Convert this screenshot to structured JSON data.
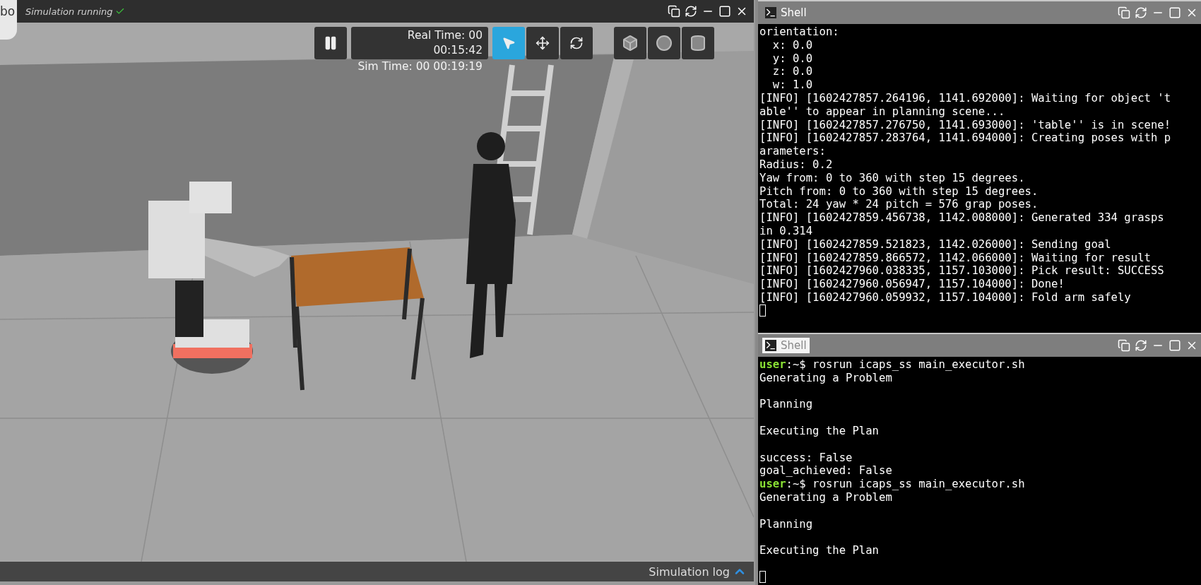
{
  "sim_window": {
    "tab_label": "bo",
    "status": "Simulation running",
    "status_ok": true,
    "toolbar": {
      "paused": false,
      "real_time_label": "Real Time: 00",
      "real_time_value": "00:15:42",
      "sim_time": "Sim Time: 00 00:19:19",
      "modes": [
        {
          "kind": "select",
          "selected": true
        },
        {
          "kind": "translate",
          "selected": false
        },
        {
          "kind": "rotate",
          "selected": false
        }
      ],
      "shapes": [
        {
          "kind": "box"
        },
        {
          "kind": "sphere"
        },
        {
          "kind": "cylinder"
        }
      ]
    },
    "log_label": "Simulation log"
  },
  "shells": [
    {
      "title": "Shell",
      "highlighted": false,
      "lines": [
        {
          "kind": "text",
          "text": "orientation:"
        },
        {
          "kind": "text",
          "text": "  x: 0.0"
        },
        {
          "kind": "text",
          "text": "  y: 0.0"
        },
        {
          "kind": "text",
          "text": "  z: 0.0"
        },
        {
          "kind": "text",
          "text": "  w: 1.0"
        },
        {
          "kind": "text",
          "text": "[INFO] [1602427857.264196, 1141.692000]: Waiting for object 't"
        },
        {
          "kind": "text",
          "text": "able'' to appear in planning scene..."
        },
        {
          "kind": "text",
          "text": "[INFO] [1602427857.276750, 1141.693000]: 'table'' is in scene!"
        },
        {
          "kind": "text",
          "text": "[INFO] [1602427857.283764, 1141.694000]: Creating poses with p"
        },
        {
          "kind": "text",
          "text": "arameters:"
        },
        {
          "kind": "text",
          "text": "Radius: 0.2"
        },
        {
          "kind": "text",
          "text": "Yaw from: 0 to 360 with step 15 degrees."
        },
        {
          "kind": "text",
          "text": "Pitch from: 0 to 360 with step 15 degrees."
        },
        {
          "kind": "text",
          "text": "Total: 24 yaw * 24 pitch = 576 grap poses."
        },
        {
          "kind": "text",
          "text": "[INFO] [1602427859.456738, 1142.008000]: Generated 334 grasps"
        },
        {
          "kind": "text",
          "text": "in 0.314"
        },
        {
          "kind": "text",
          "text": "[INFO] [1602427859.521823, 1142.026000]: Sending goal"
        },
        {
          "kind": "text",
          "text": "[INFO] [1602427859.866572, 1142.066000]: Waiting for result"
        },
        {
          "kind": "text",
          "text": "[INFO] [1602427960.038335, 1157.103000]: Pick result: SUCCESS"
        },
        {
          "kind": "text",
          "text": "[INFO] [1602427960.056947, 1157.104000]: Done!"
        },
        {
          "kind": "text",
          "text": "[INFO] [1602427960.059932, 1157.104000]: Fold arm safely"
        },
        {
          "kind": "cursor"
        }
      ]
    },
    {
      "title": "Shell",
      "highlighted": true,
      "lines": [
        {
          "kind": "prompt",
          "user": "user",
          "text": ":~$ rosrun icaps_ss main_executor.sh"
        },
        {
          "kind": "text",
          "text": "Generating a Problem"
        },
        {
          "kind": "blank"
        },
        {
          "kind": "text",
          "text": "Planning"
        },
        {
          "kind": "blank"
        },
        {
          "kind": "text",
          "text": "Executing the Plan"
        },
        {
          "kind": "blank"
        },
        {
          "kind": "text",
          "text": "success: False"
        },
        {
          "kind": "text",
          "text": "goal_achieved: False"
        },
        {
          "kind": "prompt",
          "user": "user",
          "text": ":~$ rosrun icaps_ss main_executor.sh"
        },
        {
          "kind": "text",
          "text": "Generating a Problem"
        },
        {
          "kind": "blank"
        },
        {
          "kind": "text",
          "text": "Planning"
        },
        {
          "kind": "blank"
        },
        {
          "kind": "text",
          "text": "Executing the Plan"
        },
        {
          "kind": "blank"
        },
        {
          "kind": "cursor"
        }
      ]
    }
  ]
}
